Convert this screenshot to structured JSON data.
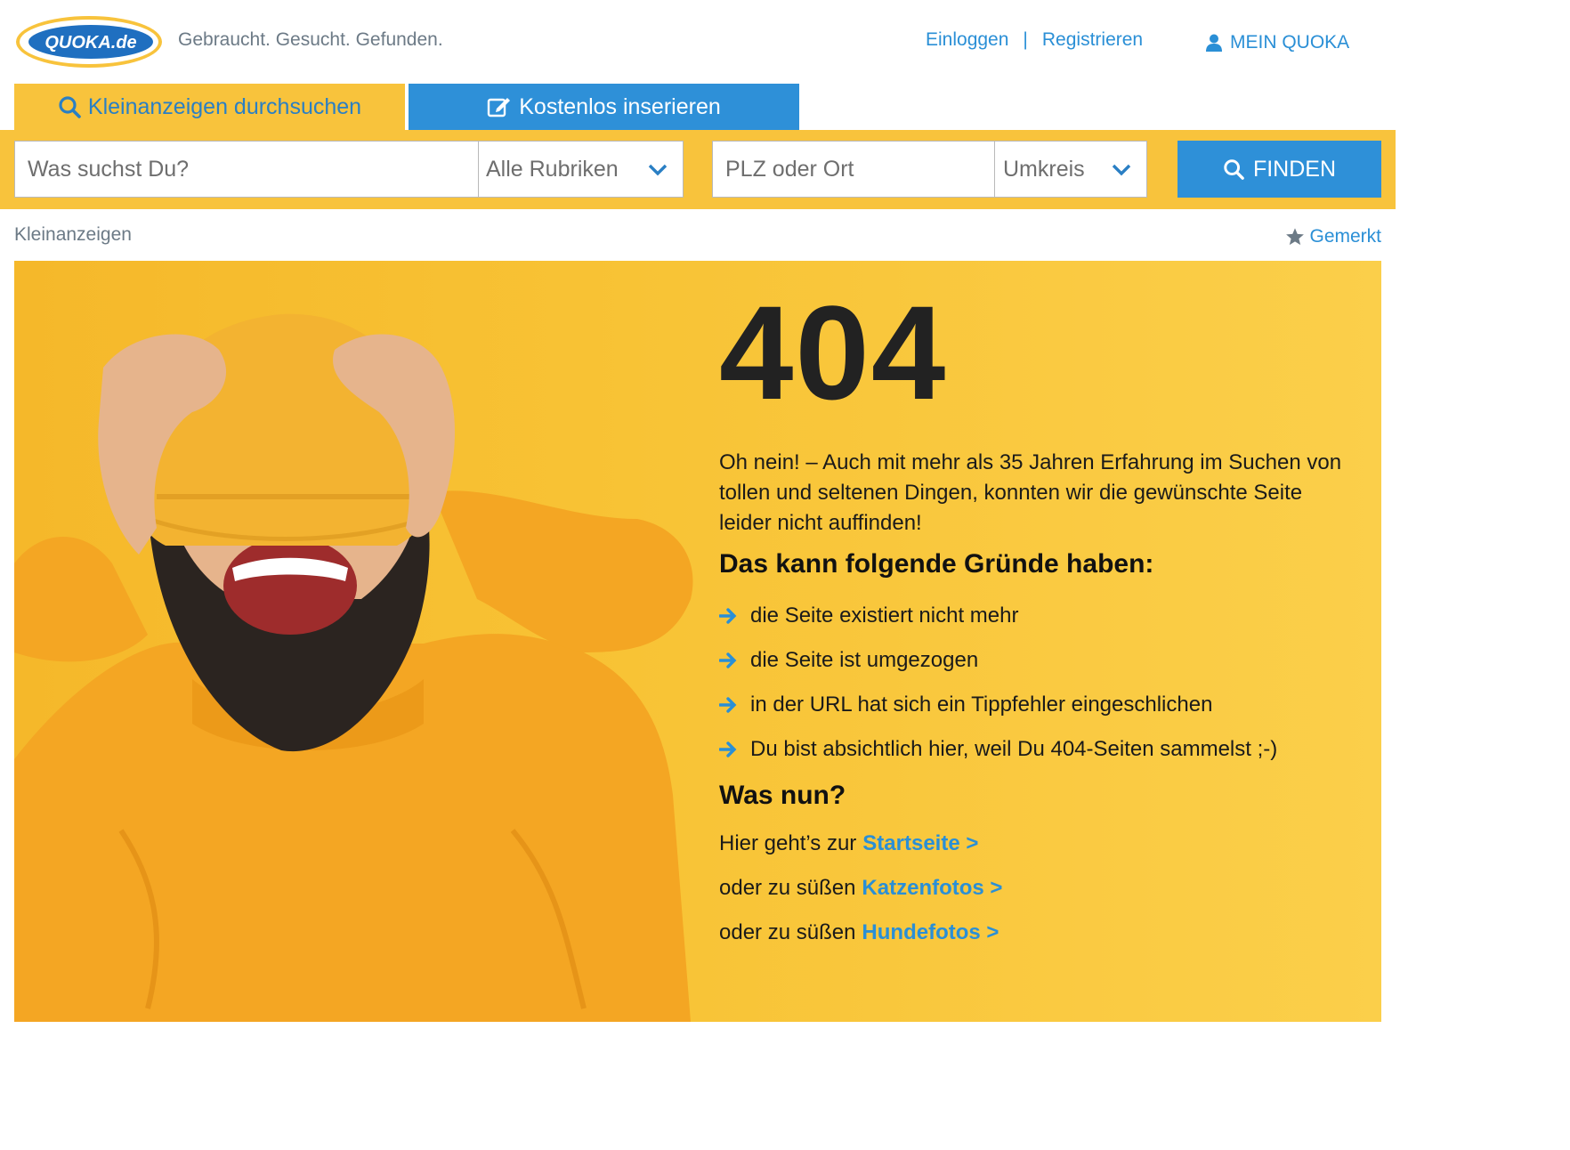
{
  "header": {
    "logo_text": "QUOKA.de",
    "tagline": "Gebraucht. Gesucht. Gefunden.",
    "login": "Einloggen",
    "separator": "|",
    "register": "Registrieren",
    "my_account": "MEIN QUOKA"
  },
  "tabs": [
    {
      "label": "Kleinanzeigen durchsuchen",
      "icon": "search-icon",
      "active": true
    },
    {
      "label": "Kostenlos inserieren",
      "icon": "edit-icon",
      "active": false
    }
  ],
  "search": {
    "query_placeholder": "Was suchst Du?",
    "category_selected": "Alle Rubriken",
    "location_placeholder": "PLZ oder Ort",
    "radius_selected": "Umkreis",
    "submit_label": "FINDEN"
  },
  "breadcrumb": "Kleinanzeigen",
  "bookmarks": "Gemerkt",
  "error": {
    "code": "404",
    "intro": "Oh nein! – Auch mit mehr als 35 Jahren Erfahrung im Suchen von tollen und seltenen Dingen, konnten wir die gewünschte Seite leider nicht auffinden!",
    "reasons_heading": "Das kann folgende Gründe haben:",
    "reasons": [
      "die Seite existiert nicht mehr",
      "die Seite ist umgezogen",
      "in der URL hat sich ein Tippfehler eingeschlichen",
      "Du bist absichtlich hier, weil Du 404-Seiten sammelst ;-)"
    ],
    "next_heading": "Was nun?",
    "links": [
      {
        "prefix": "Hier geht’s zur",
        "link": "Startseite >"
      },
      {
        "prefix": "oder zu süßen",
        "link": "Katzenfotos >"
      },
      {
        "prefix": "oder zu süßen",
        "link": "Hundefotos >"
      }
    ]
  },
  "colors": {
    "brand_yellow": "#f8c33c",
    "brand_blue": "#2e90d8",
    "link_blue": "#2a8fd6",
    "text_dark": "#1a1a1a"
  }
}
